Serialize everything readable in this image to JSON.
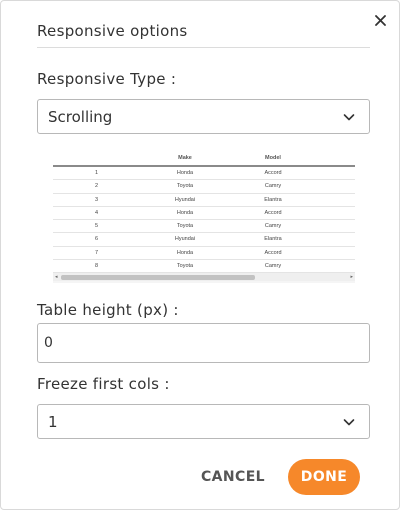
{
  "dialog": {
    "title": "Responsive options",
    "close_icon": "close-icon"
  },
  "responsive_type": {
    "label": "Responsive Type :",
    "value": "Scrolling"
  },
  "preview": {
    "headers": [
      "",
      "Make",
      "Model"
    ],
    "rows": [
      [
        "1",
        "Honda",
        "Accord"
      ],
      [
        "2",
        "Toyota",
        "Camry"
      ],
      [
        "3",
        "Hyundai",
        "Elantra"
      ],
      [
        "4",
        "Honda",
        "Accord"
      ],
      [
        "5",
        "Toyota",
        "Camry"
      ],
      [
        "6",
        "Hyundai",
        "Elantra"
      ],
      [
        "7",
        "Honda",
        "Accord"
      ],
      [
        "8",
        "Toyota",
        "Camry"
      ]
    ],
    "scroll_left": "◂",
    "scroll_right": "▸"
  },
  "table_height": {
    "label": "Table height (px) :",
    "value": "0"
  },
  "freeze_cols": {
    "label": "Freeze first cols :",
    "value": "1"
  },
  "buttons": {
    "cancel": "CANCEL",
    "done": "DONE"
  },
  "colors": {
    "accent": "#f6882a",
    "text": "#333333",
    "border": "#b8b8b8"
  }
}
